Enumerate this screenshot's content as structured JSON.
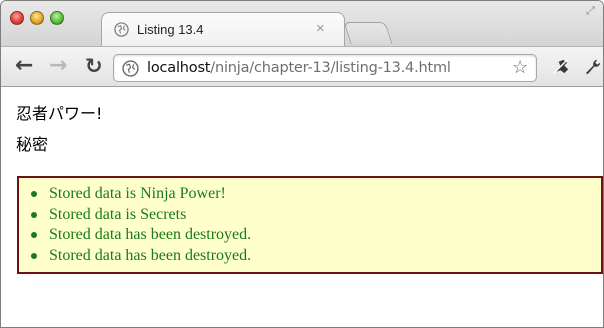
{
  "browser": {
    "tab_title": "Listing 13.4",
    "tab_close": "×",
    "url_host": "localhost",
    "url_path": "/ninja/chapter-13/listing-13.4.html"
  },
  "page": {
    "line1": "忍者パワー!",
    "line2": "秘密",
    "results": [
      "Stored data is Ninja Power!",
      "Stored data is Secrets",
      "Stored data has been destroyed.",
      "Stored data has been destroyed."
    ],
    "results_text_color": "#1b7a1b",
    "results_background": "#ffffcc",
    "results_border": "#6b1212"
  }
}
